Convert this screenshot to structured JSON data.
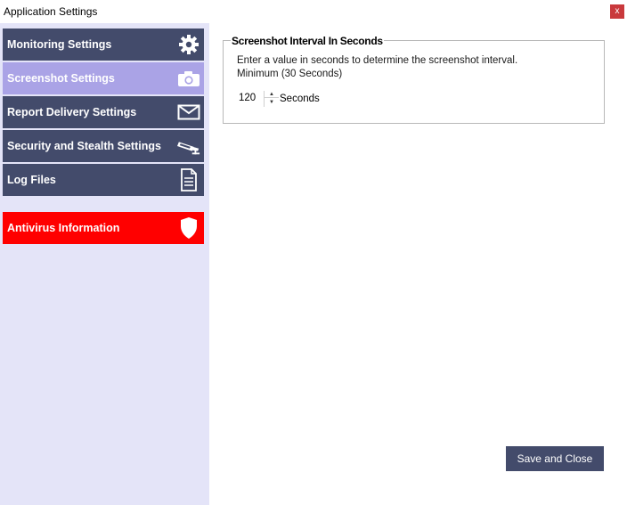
{
  "window": {
    "title": "Application Settings",
    "close_label": "x"
  },
  "sidebar": {
    "items": [
      {
        "label": "Monitoring Settings",
        "icon": "gear-icon",
        "state": "normal"
      },
      {
        "label": "Screenshot Settings",
        "icon": "camera-icon",
        "state": "active"
      },
      {
        "label": "Report Delivery Settings",
        "icon": "envelope-icon",
        "state": "normal"
      },
      {
        "label": "Security and Stealth Settings",
        "icon": "security-camera-icon",
        "state": "normal"
      },
      {
        "label": "Log Files",
        "icon": "document-icon",
        "state": "normal"
      },
      {
        "label": "Antivirus Information",
        "icon": "shield-icon",
        "state": "alert"
      }
    ]
  },
  "screenshot_interval": {
    "title": "Screenshot Interval In Seconds",
    "description_line1": "Enter a value in seconds to determine the screenshot interval.",
    "description_line2": "Minimum (30 Seconds)",
    "value": "120",
    "unit": "Seconds"
  },
  "footer": {
    "save_label": "Save and Close"
  },
  "colors": {
    "nav_normal": "#434b6b",
    "nav_active": "#aaa3e6",
    "nav_alert": "#ff0000",
    "sidebar_bg": "#e4e4f8",
    "close_button": "#c9393c"
  }
}
